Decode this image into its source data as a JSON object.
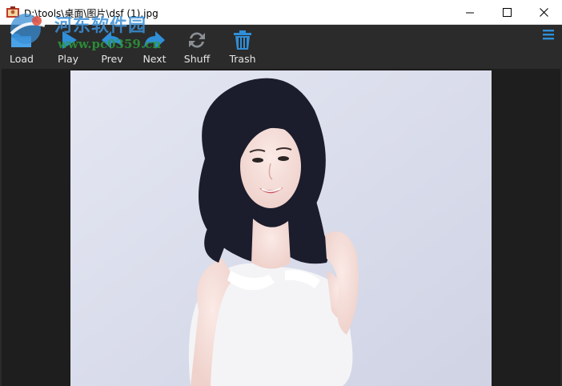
{
  "window": {
    "title": "D:\\tools\\桌面\\图片\\dsf (1).jpg",
    "controls": {
      "minimize": "—",
      "maximize": "☐",
      "close": "✕"
    }
  },
  "watermark": {
    "site_name": "河东软件园",
    "site_url": "www.pc0359.cn"
  },
  "toolbar": {
    "items": [
      {
        "label": "Load",
        "icon": "folder-icon"
      },
      {
        "label": "Play",
        "icon": "play-icon"
      },
      {
        "label": "Prev",
        "icon": "prev-arrow-icon"
      },
      {
        "label": "Next",
        "icon": "next-arrow-icon"
      },
      {
        "label": "Shuff",
        "icon": "shuffle-icon"
      },
      {
        "label": "Trash",
        "icon": "trash-icon"
      }
    ],
    "menu_icon": "hamburger-menu-icon"
  },
  "colors": {
    "toolbar_bg": "#2b2b2b",
    "viewer_bg": "#1e1e1e",
    "accent_blue": "#2f8fd8",
    "icon_grey": "#8a8f95"
  },
  "viewer": {
    "image_content": "photo"
  }
}
